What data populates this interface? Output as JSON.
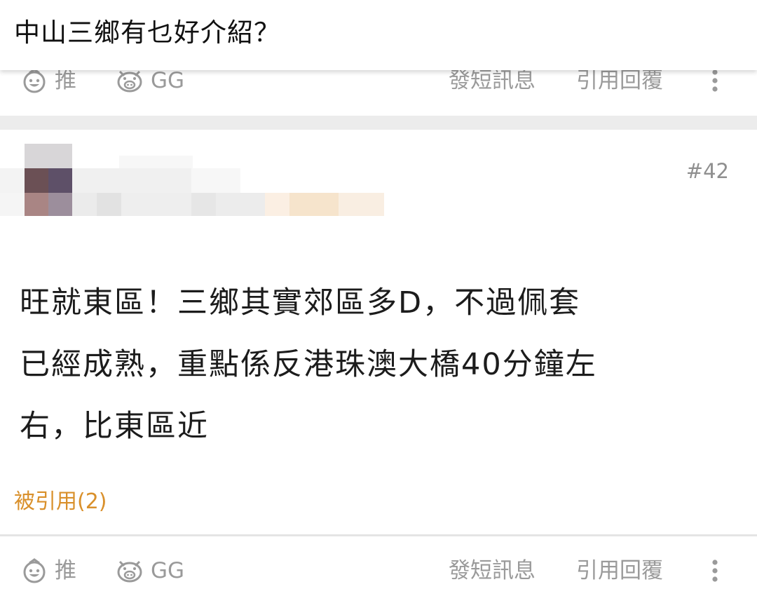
{
  "thread": {
    "title": "中山三鄉有乜好介紹？"
  },
  "actions": {
    "push_label": "推",
    "gg_label": "GG",
    "pm_label": "發短訊息",
    "quote_label": "引用回覆",
    "push_icon": "smiley-face-icon",
    "gg_icon": "pig-face-icon",
    "more_icon": "vertical-dots-icon"
  },
  "post": {
    "number": "#42",
    "body_lines": [
      "旺就東區！三鄉其實郊區多D，不過佩套",
      "已經成熟，重點係反港珠澳大橋40分鐘左",
      "右，比東區近"
    ],
    "quoted_by": "被引用(2)"
  },
  "colors": {
    "icon_gray": "#9a9a9a",
    "quoted_orange": "#d9902b",
    "separator": "#ececec"
  }
}
